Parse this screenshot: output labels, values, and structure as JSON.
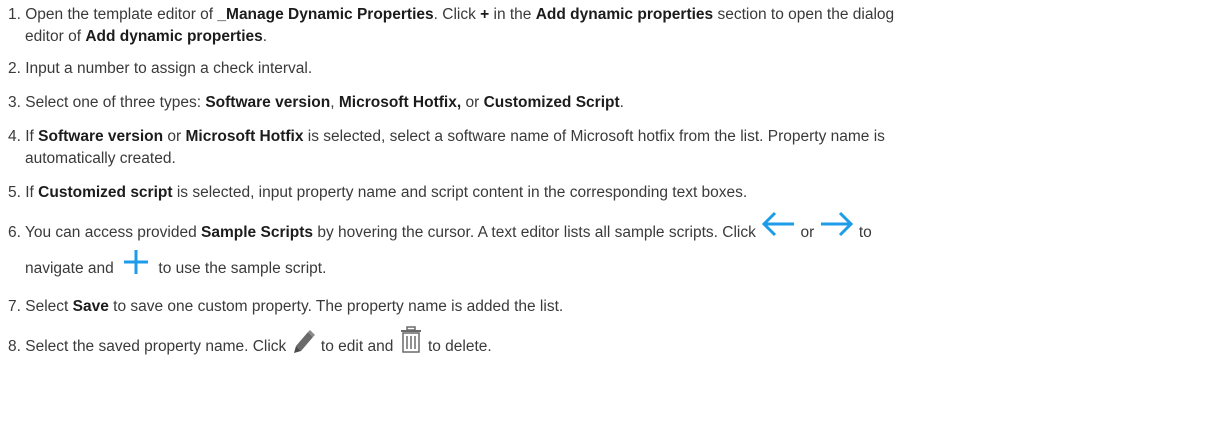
{
  "steps": [
    {
      "num": "1.",
      "t1": "Open the template editor of ",
      "b1": "_Manage Dynamic Properties",
      "t2": ". Click ",
      "b2": "+",
      "t3": " in the ",
      "b3": "Add dynamic properties",
      "t4": " section to open the dialog",
      "line2_t1": "editor of ",
      "line2_b1": "Add dynamic properties",
      "line2_t2": "."
    },
    {
      "num": "2.",
      "t1": "Input a number to assign a check interval."
    },
    {
      "num": "3.",
      "t1": "Select one of three types: ",
      "b1": "Software version",
      "t2": ", ",
      "b2": "Microsoft Hotfix,",
      "t3": " or ",
      "b3": "Customized Script",
      "t4": "."
    },
    {
      "num": "4.",
      "t1": "If ",
      "b1": "Software version",
      "t2": " or ",
      "b2": "Microsoft Hotfix",
      "t3": " is selected, select a software name of Microsoft hotfix from the list. Property name is",
      "line2": "automatically created."
    },
    {
      "num": "5.",
      "t1": "If ",
      "b1": "Customized script",
      "t2": " is selected, input property name and script content in the corresponding text boxes."
    },
    {
      "num": "6.",
      "t1": "You can access provided ",
      "b1": "Sample Scripts",
      "t2": " by hovering the cursor. A text editor lists all sample scripts. Click ",
      "t3": "or",
      "t4": "to",
      "line2_t1": "navigate and ",
      "line2_t2": " to use the sample script."
    },
    {
      "num": "7.",
      "t1": "Select ",
      "b1": "Save",
      "t2": " to save one custom property. The property name is added the list."
    },
    {
      "num": "8.",
      "t1": "Select the saved property name. Click ",
      "t2": " to edit and ",
      "t3": " to delete."
    }
  ],
  "icons": {
    "arrow_left": "arrow-left-icon",
    "arrow_right": "arrow-right-icon",
    "plus": "plus-icon",
    "pencil": "pencil-icon",
    "trash": "trash-icon"
  },
  "colors": {
    "text": "#3a3a3a",
    "bold_text": "#1c1c1c",
    "icon_blue": "#1e9be9",
    "icon_gray": "#6a6a6a"
  }
}
